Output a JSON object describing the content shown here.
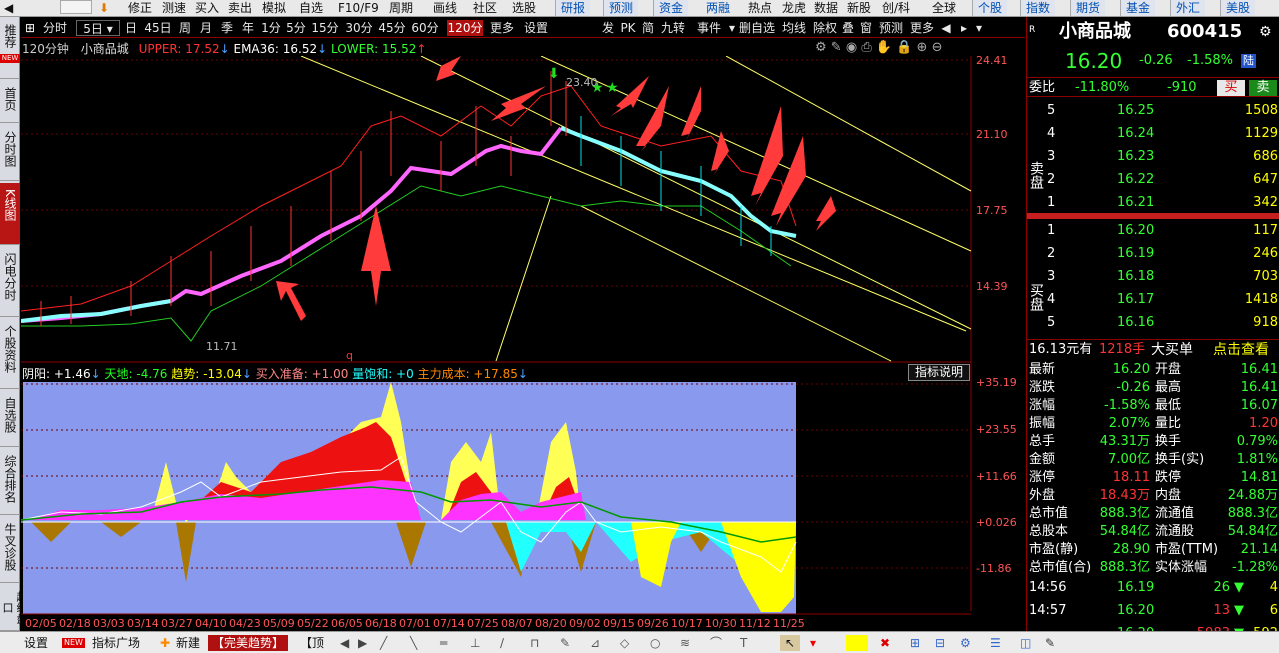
{
  "toolbar": {
    "items": [
      "修正",
      "测速",
      "买入",
      "卖出",
      "模拟",
      "自选",
      "F10/F9",
      "周期",
      "画线",
      "社区",
      "选股"
    ],
    "tabs": [
      "研报",
      "预测",
      "资金",
      "两融",
      "热点",
      "龙虎",
      "数据",
      "新股",
      "创/科",
      "全球",
      "个股",
      "指数",
      "期货",
      "基金",
      "外汇",
      "美股"
    ]
  },
  "left_nav": [
    {
      "label": "推荐",
      "badge": "NEW"
    },
    {
      "label": "首页"
    },
    {
      "label": "分时图"
    },
    {
      "label": "K线图",
      "active": true
    },
    {
      "label": "闪电分时"
    },
    {
      "label": "个股资料"
    },
    {
      "label": "自选股"
    },
    {
      "label": "综合排名"
    },
    {
      "label": "牛叉诊股"
    },
    {
      "label": "超级盘口"
    }
  ],
  "periods": [
    "分时",
    "5日",
    "日",
    "45日",
    "周",
    "月",
    "季",
    "年",
    "1分",
    "5分",
    "15分",
    "30分",
    "45分",
    "60分",
    "120分",
    "更多",
    "设置"
  ],
  "selected_period": "120分",
  "right_tools": [
    "发",
    "PK",
    "简",
    "九转",
    "事件",
    "删自选",
    "均线",
    "除权",
    "叠",
    "窗",
    "预测",
    "更多"
  ],
  "chart_title": {
    "period": "120分钟",
    "name": "小商品城",
    "upper": "UPPER: 17.52",
    "ema": "EMA36: 16.52",
    "lower": "LOWER: 15.52"
  },
  "price_axis": [
    "24.41",
    "21.10",
    "17.75",
    "14.39"
  ],
  "annotations": {
    "high": "23.40",
    "low": "11.71"
  },
  "indicator": {
    "yinyang": "阴阳: +1.46",
    "tiandi": "天地: -4.76",
    "qushi": "趋势: -13.04",
    "mairu": "买入准备: +1.00",
    "liangbaohe": "量饱和: +0",
    "zhuli": "主力成本: +17.85",
    "help": "指标说明"
  },
  "indicator_axis": [
    "+35.19",
    "+23.55",
    "+11.66",
    "+0.026",
    "-11.86"
  ],
  "dates": [
    "02/05",
    "02/18",
    "03/03",
    "03/14",
    "03/27",
    "04/10",
    "04/23",
    "05/09",
    "05/22",
    "06/05",
    "06/18",
    "07/01",
    "07/14",
    "07/25",
    "08/07",
    "08/20",
    "09/02",
    "09/15",
    "09/26",
    "10/17",
    "10/30",
    "11/12",
    "11/25"
  ],
  "stock": {
    "name": "小商品城",
    "code": "600415",
    "price": "16.20",
    "change": "-0.26",
    "pct": "-1.58%",
    "tag": "陆",
    "weibi_label": "委比",
    "weibi": "-11.80%",
    "weicha": "-910",
    "buy_btn": "买",
    "sell_btn": "卖",
    "sell_side_label": "卖盘",
    "buy_side_label": "买盘"
  },
  "asks": [
    {
      "lvl": "5",
      "price": "16.25",
      "vol": "1508"
    },
    {
      "lvl": "4",
      "price": "16.24",
      "vol": "1129"
    },
    {
      "lvl": "3",
      "price": "16.23",
      "vol": "686"
    },
    {
      "lvl": "2",
      "price": "16.22",
      "vol": "647"
    },
    {
      "lvl": "1",
      "price": "16.21",
      "vol": "342"
    }
  ],
  "bids": [
    {
      "lvl": "1",
      "price": "16.20",
      "vol": "117"
    },
    {
      "lvl": "2",
      "price": "16.19",
      "vol": "246"
    },
    {
      "lvl": "3",
      "price": "16.18",
      "vol": "703"
    },
    {
      "lvl": "4",
      "price": "16.17",
      "vol": "1418"
    },
    {
      "lvl": "5",
      "price": "16.16",
      "vol": "918"
    }
  ],
  "big_order": {
    "price": "16.13元有",
    "qty": "1218手",
    "label": "大买单",
    "link": "点击查看"
  },
  "quote": [
    [
      "最新",
      "16.20",
      "开盘",
      "16.41"
    ],
    [
      "涨跌",
      "-0.26",
      "最高",
      "16.41"
    ],
    [
      "涨幅",
      "-1.58%",
      "最低",
      "16.07"
    ],
    [
      "振幅",
      "2.07%",
      "量比",
      "1.20"
    ],
    [
      "总手",
      "43.31万",
      "换手",
      "0.79%"
    ],
    [
      "金额",
      "7.00亿",
      "换手(实)",
      "1.81%"
    ],
    [
      "涨停",
      "18.11",
      "跌停",
      "14.81"
    ],
    [
      "外盘",
      "18.43万",
      "内盘",
      "24.88万"
    ],
    [
      "总市值",
      "888.3亿",
      "流通值",
      "888.3亿"
    ],
    [
      "总股本",
      "54.84亿",
      "流通股",
      "54.84亿"
    ],
    [
      "市盈(静)",
      "28.90",
      "市盈(TTM)",
      "21.14"
    ],
    [
      "总市值(合)",
      "888.3亿",
      "实体涨幅",
      "-1.28%"
    ]
  ],
  "ticks": [
    {
      "time": "14:56",
      "price": "16.19",
      "vol": "26",
      "dir": "down",
      "n": "4"
    },
    {
      "time": "14:57",
      "price": "16.20",
      "vol": "13",
      "dir": "down",
      "n": "6"
    },
    {
      "time": "",
      "price": "16.20",
      "vol": "5983",
      "dir": "down",
      "n": "592"
    }
  ],
  "bottom": {
    "settings": "设置",
    "new_badge": "NEW",
    "plaza": "指标广场",
    "create": "新建",
    "tab1": "【完美趋势】",
    "tab2": "【顶"
  },
  "colors": {
    "up": "#ff3333",
    "down": "#33ff33",
    "yellow": "#ffff00",
    "cyan": "#00ffff",
    "magenta": "#ff00ff",
    "red_dark": "#8b0000"
  }
}
